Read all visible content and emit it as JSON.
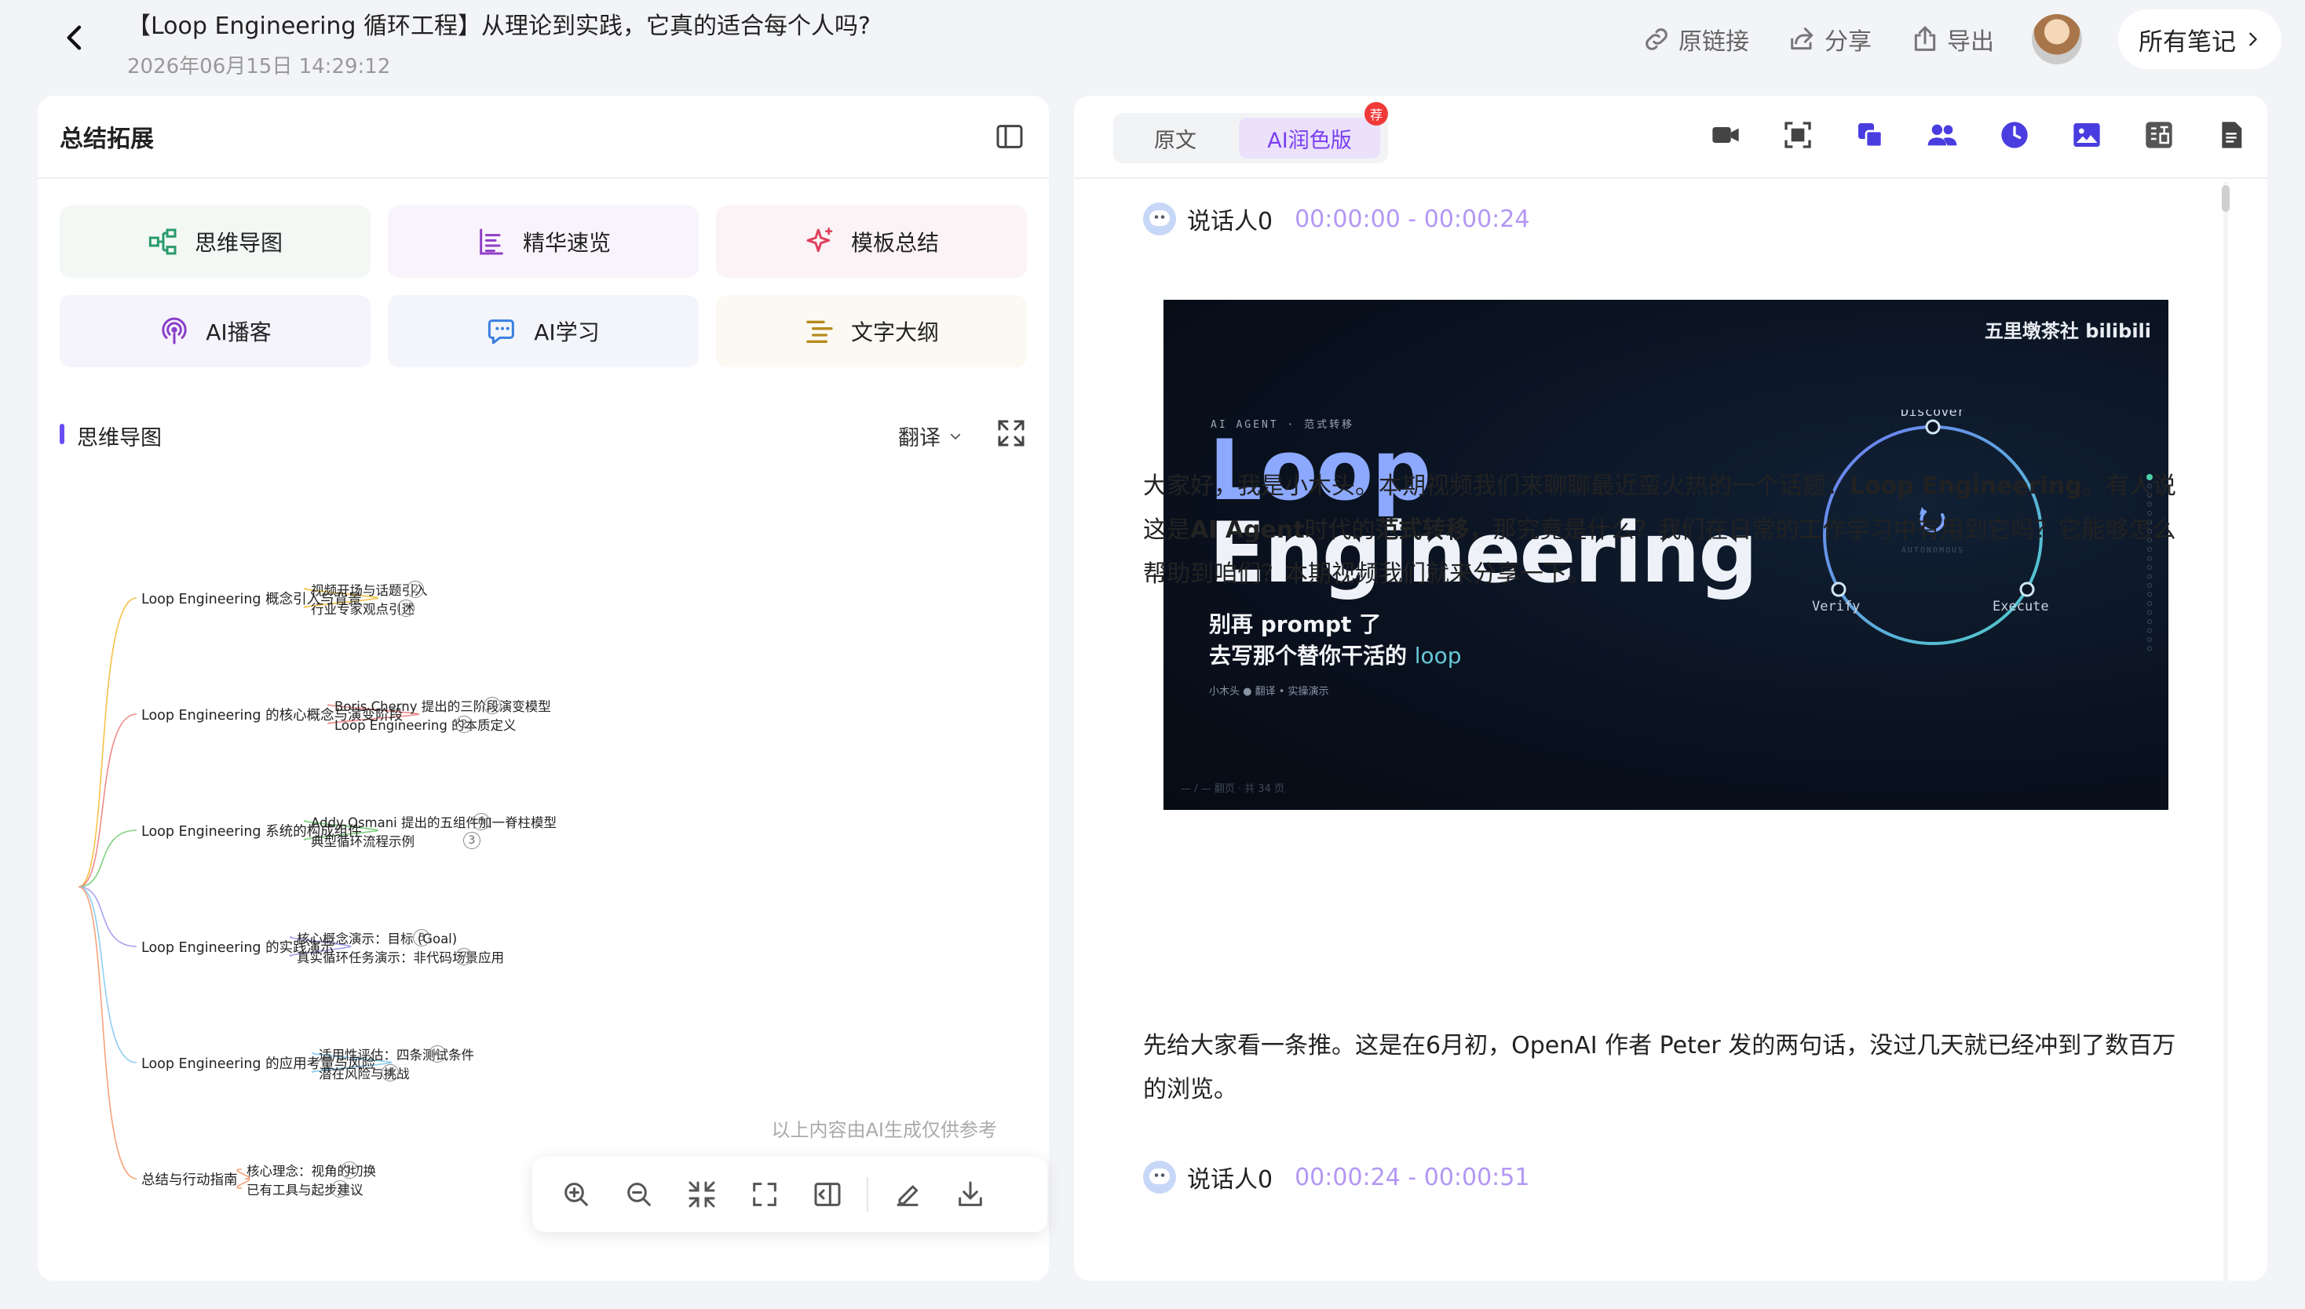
{
  "header": {
    "title": "【Loop Engineering 循环工程】从理论到实践，它真的适合每个人吗?",
    "datetime": "2026年06月15日 14:29:12",
    "actions": {
      "source_link": "原链接",
      "share": "分享",
      "export": "导出"
    },
    "all_notes": "所有笔记"
  },
  "left": {
    "title": "总结拓展",
    "features": [
      {
        "label": "思维导图",
        "icon": "mindmap-icon",
        "bg": "#f3f8f5",
        "color": "#2a9b6b"
      },
      {
        "label": "精华速览",
        "icon": "list-icon",
        "bg": "#f9f3fb",
        "color": "#8f3fc7"
      },
      {
        "label": "模板总结",
        "icon": "sparkle-icon",
        "bg": "#fbf3f6",
        "color": "#e0405e"
      },
      {
        "label": "AI播客",
        "icon": "podcast-icon",
        "bg": "#f5f3fb",
        "color": "#8a3ec9"
      },
      {
        "label": "AI学习",
        "icon": "chat-icon",
        "bg": "#f3f5fb",
        "color": "#3a7fe0"
      },
      {
        "label": "文字大纲",
        "icon": "outline-icon",
        "bg": "#fbf9f2",
        "color": "#b58a1e"
      }
    ],
    "mindmap": {
      "section_title": "思维导图",
      "translate_label": "翻译",
      "ai_note": "以上内容由AI生成仅供参考",
      "branches": [
        {
          "label": "Loop Engineering 概念引入与背景",
          "color": "#f5c24a",
          "children": [
            {
              "label": "视频开场与话题引入",
              "count": "2"
            },
            {
              "label": "行业专家观点引述",
              "count": "3"
            }
          ]
        },
        {
          "label": "Loop Engineering 的核心概念与演变阶段",
          "color": "#f08a8a",
          "children": [
            {
              "label": "Boris Cherny 提出的三阶段演变模型",
              "count": "3"
            },
            {
              "label": "Loop Engineering 的本质定义",
              "count": "2"
            }
          ]
        },
        {
          "label": "Loop Engineering 系统的构成组件",
          "color": "#7ed07e",
          "children": [
            {
              "label": "Addy Osmani 提出的五组件加一脊柱模型",
              "count": "6"
            },
            {
              "label": "典型循环流程示例",
              "count": "3"
            }
          ]
        },
        {
          "label": "Loop Engineering 的实践演示",
          "color": "#a8a2ee",
          "children": [
            {
              "label": "核心概念演示：目标 (Goal)",
              "count": "3"
            },
            {
              "label": "真实循环任务演示：非代码场景应用",
              "count": "7"
            }
          ]
        },
        {
          "label": "Loop Engineering 的应用考量与风险",
          "color": "#8ecdf0",
          "children": [
            {
              "label": "适用性评估：四条测试条件",
              "count": "4"
            },
            {
              "label": "潜在风险与挑战",
              "count": "4"
            }
          ]
        },
        {
          "label": "总结与行动指南",
          "color": "#f5a27a",
          "children": [
            {
              "label": "核心理念：视角的切换",
              "count": "1"
            },
            {
              "label": "已有工具与起步建议",
              "count": "3"
            }
          ]
        }
      ]
    }
  },
  "right": {
    "tabs": {
      "original": "原文",
      "ai": "AI润色版",
      "badge": "荐"
    },
    "speakers": [
      {
        "name": "说话人0",
        "time": "00:00:00 - 00:00:24"
      },
      {
        "name": "说话人0",
        "time": "00:00:24 - 00:00:51"
      }
    ],
    "video": {
      "brand": "五里墩茶社 bilibili",
      "tag": "AI AGENT · 范式转移",
      "title_1": "Loop",
      "title_2": "Engineering",
      "sub_1": "别再 prompt 了",
      "sub_2_prefix": "去写那个替你干活的 ",
      "sub_2_highlight": "loop",
      "meta": "小木头  ●  翻译  •  实操演示",
      "footer": "— / — 翻页 · 共 34 页",
      "cycle": {
        "top": "Discover",
        "left": "Verify",
        "right": "Execute",
        "center": "AUTONOMOUS"
      }
    },
    "para1": {
      "a": "大家好，我是小木头。本期视频我们来聊聊最近蛮火热的一个话题：",
      "b": "Loop Engineering",
      "c": "。有人说这是",
      "d": "AI Agent",
      "e": "时代的",
      "f": "范式转移",
      "g": "，那究竟是什么？我们在日常的工作学习中有用到它吗？它能够怎么帮助到咱们？本期视频我们就来分享一下。"
    },
    "para2": "先给大家看一条推。这是在6月初，OpenAI 作者 Peter 发的两句话，没过几天就已经冲到了数百万的浏览。"
  },
  "theme": {
    "accent": "#6a4cf5",
    "tool_color": "#4a3de0",
    "time_color": "#b397f5"
  }
}
